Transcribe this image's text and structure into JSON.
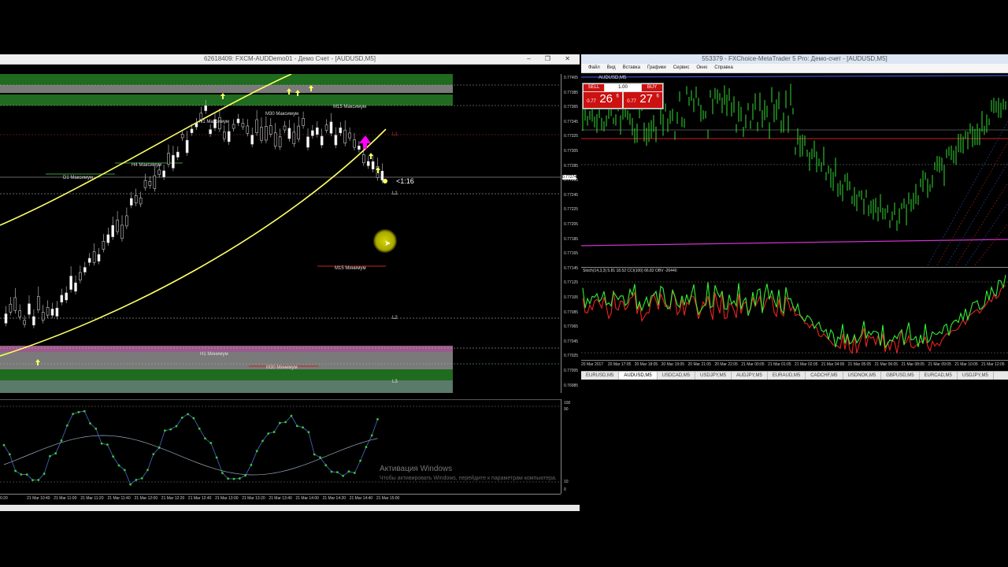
{
  "left_window": {
    "title": "62618409: FXCM-AUDDemo01 - Демо Счет - [AUDUSD,M5]",
    "window_controls": "‒ ❐ ✕",
    "chart_labels": {
      "d1_max": "D1 Максимум",
      "h4_max": "H4 Максимум",
      "h1_max": "H1 Максимум",
      "m30_max": "M30 Максимум",
      "m15_max": "M15 Максимум",
      "m15_min": "M15 Минимум",
      "h1_min": "H1 Минимум",
      "m30_min": "M30 Минимум",
      "timer": "<1:16",
      "l1_top": "L1",
      "l1": "L1",
      "l2": "L2",
      "l3": "L3"
    },
    "prices": [
      "0.77405",
      "0.77385",
      "0.77365",
      "0.77345",
      "0.77325",
      "0.77305",
      "0.77285",
      "0.77265",
      "0.77245",
      "0.77225",
      "0.77205",
      "0.77185",
      "0.77165",
      "0.77145",
      "0.77125",
      "0.77105",
      "0.77085",
      "0.77065",
      "0.77045",
      "0.77025",
      "0.77005",
      "0.76985"
    ],
    "current_price": "0.77274",
    "osc_levels": [
      "100",
      "90",
      "10",
      "0"
    ],
    "times": [
      "0:20",
      "21 Mar 10:40",
      "21 Mar 11:00",
      "21 Mar 11:20",
      "21 Mar 11:40",
      "21 Mar 12:00",
      "21 Mar 12:20",
      "21 Mar 12:40",
      "21 Mar 13:00",
      "21 Mar 13:20",
      "21 Mar 13:40",
      "21 Mar 14:00",
      "21 Mar 14:20",
      "21 Mar 14:40",
      "21 Mar 15:00"
    ]
  },
  "right_window": {
    "title": "553379 - FXChoice-MetaTrader 5 Pro: Демо-счет - [AUDUSD,M5]",
    "menu": [
      "Файл",
      "Вид",
      "Вставка",
      "Графики",
      "Сервис",
      "Окно",
      "Справка"
    ],
    "symbol": "AUDUSD,M5",
    "sell_label": "SELL",
    "buy_label": "BUY",
    "lot": "1.00",
    "sell_price_small": "0.77",
    "sell_price_big": "26",
    "sell_price_sup": "6",
    "buy_price_small": "0.77",
    "buy_price_big": "27",
    "buy_price_sup": "6",
    "indicator_label": "Stoch(14,3,3) 5.81 18.52 CCI(100) 66.82 OBV -26440",
    "times": [
      "20 Mar 2017",
      "20 Mar 17:05",
      "20 Mar 18:05",
      "20 Mar 19:05",
      "20 Mar 21:05",
      "20 Mar 22:05",
      "21 Mar 00:05",
      "21 Mar 01:05",
      "21 Mar 02:05",
      "21 Mar 04:05",
      "21 Mar 05:05",
      "21 Mar 06:05",
      "21 Mar 08:05",
      "21 Mar 09:05",
      "21 Mar 10:05",
      "21 Mar 12:05"
    ],
    "tabs": [
      "EURUSD,M5",
      "AUDUSD,M5",
      "USDCAD,M5",
      "USDJPY,M5",
      "AUDJPY,M5",
      "EURAUD,M5",
      "CADCHF,M5",
      "USDNOK,M5",
      "GBPUSD,M5",
      "EURCAD,M5",
      "USDJPY,M5"
    ],
    "active_tab": 1
  },
  "watermark": {
    "title": "Активация Windows",
    "text": "Чтобы активировать Windows, перейдите к параметрам компьютера."
  },
  "colors": {
    "bull": "#ffffff",
    "bear": "#00cc00",
    "ma": "#ffff66",
    "green_zone": "#1f6b1f",
    "grey_zone": "#7a7a7a",
    "red_line": "#cc2222",
    "mt5_candle": "#33dd33",
    "magenta": "#cc33cc",
    "stoch_main": "#33ee33",
    "stoch_signal": "#ee2222"
  }
}
